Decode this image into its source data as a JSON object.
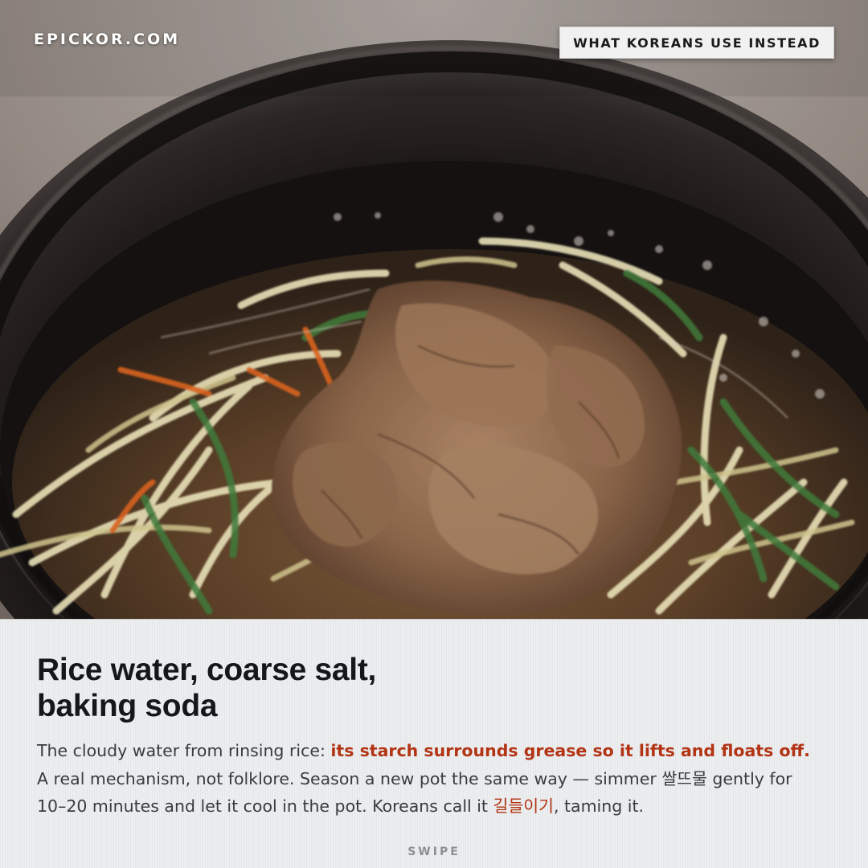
{
  "brand": "EPICKOR.COM",
  "tag": "WHAT KOREANS USE INSTEAD",
  "headline": {
    "line1": "Rice water, coarse salt,",
    "line2": "baking soda"
  },
  "body": {
    "part1": "The cloudy water from rinsing rice: ",
    "highlight1": "its starch surrounds grease so it lifts and floats off.",
    "part2": " A real mechanism, not folklore. Season a new pot the same way — simmer 쌀뜨물 gently for 10–20 minutes and let it cool in the pot. Koreans call it ",
    "highlight2": "길들이기",
    "part3": ", taming it."
  },
  "footer": {
    "swipe": "SWIPE"
  },
  "colors": {
    "accent": "#b33414",
    "headline": "#16171a",
    "body_text": "#3a3b3e",
    "panel_bg": "#eceef0"
  },
  "photo": {
    "subject": "earthenware bowl of beef bulgogi with shredded vegetables and glass noodles in broth"
  }
}
